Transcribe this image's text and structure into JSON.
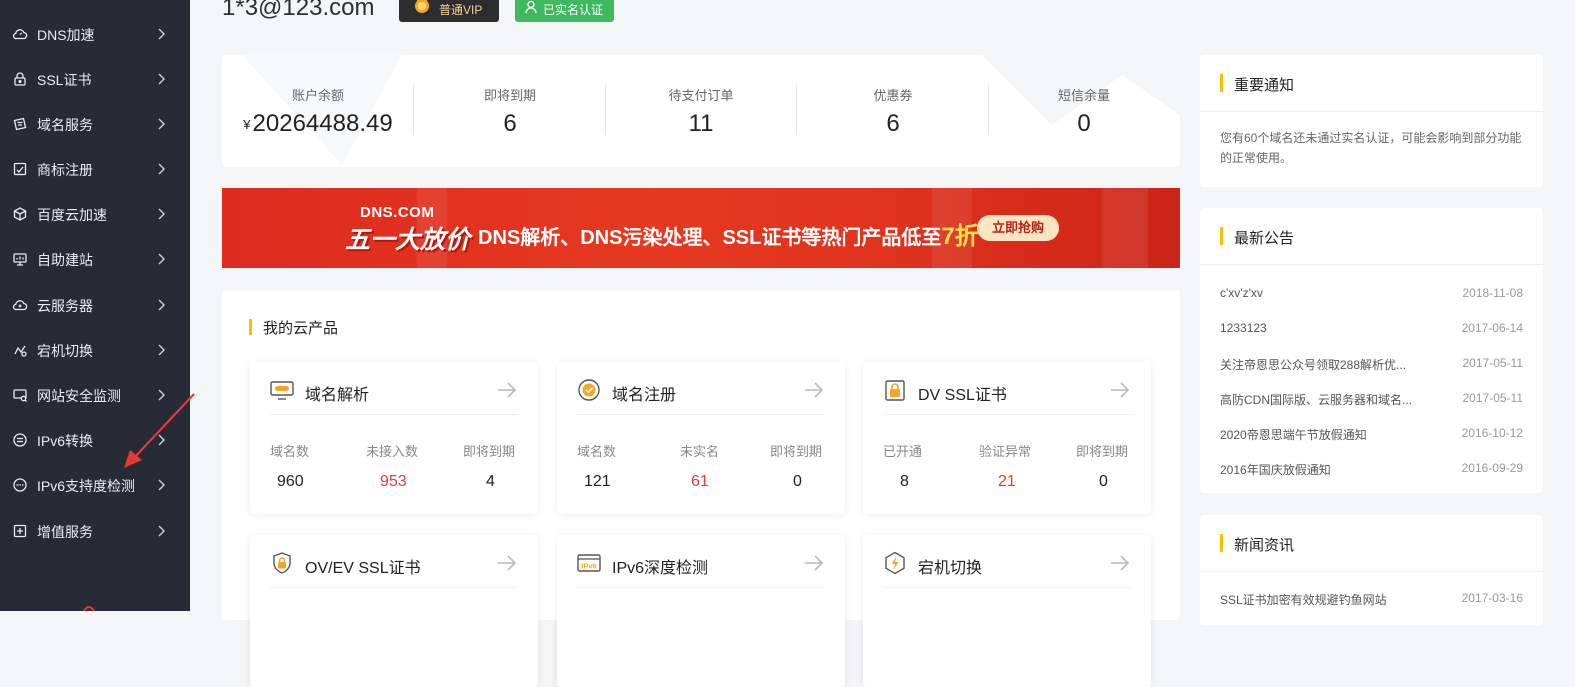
{
  "sidebar": {
    "items": [
      {
        "label": "DNS加速",
        "icon": "cloud-speed-icon"
      },
      {
        "label": "SSL证书",
        "icon": "lock-icon"
      },
      {
        "label": "域名服务",
        "icon": "domain-tag-icon"
      },
      {
        "label": "商标注册",
        "icon": "trademark-icon"
      },
      {
        "label": "百度云加速",
        "icon": "cube-icon"
      },
      {
        "label": "自助建站",
        "icon": "monitor-chart-icon"
      },
      {
        "label": "云服务器",
        "icon": "cloud-server-icon"
      },
      {
        "label": "宕机切换",
        "icon": "switch-icon"
      },
      {
        "label": "网站安全监测",
        "icon": "security-monitor-icon"
      },
      {
        "label": "IPv6转换",
        "icon": "ipv6-convert-icon"
      },
      {
        "label": "IPv6支持度检测",
        "icon": "ipv6-check-icon"
      },
      {
        "label": "增值服务",
        "icon": "value-added-icon"
      }
    ]
  },
  "header": {
    "email": "1*3@123.com",
    "vip_label": "普通VIP",
    "verified_label": "已实名认证"
  },
  "stats": {
    "currency": "¥",
    "items": [
      {
        "label": "账户余额",
        "value": "20264488.49"
      },
      {
        "label": "即将到期",
        "value": "6"
      },
      {
        "label": "待支付订单",
        "value": "11"
      },
      {
        "label": "优惠券",
        "value": "6"
      },
      {
        "label": "短信余量",
        "value": "0"
      }
    ]
  },
  "banner": {
    "brand": "DNS.COM",
    "event": "五一大放价",
    "text": "DNS解析、DNS污染处理、SSL证书等热门产品低至",
    "discount": "7折",
    "cta": "立即抢购"
  },
  "products": {
    "title": "我的云产品",
    "cards": [
      {
        "name": "域名解析",
        "icon": "dns-resolve-icon",
        "metrics": [
          {
            "label": "域名数",
            "value": "960",
            "highlight": false
          },
          {
            "label": "未接入数",
            "value": "953",
            "highlight": true
          },
          {
            "label": "即将到期",
            "value": "4",
            "highlight": false
          }
        ]
      },
      {
        "name": "域名注册",
        "icon": "domain-register-icon",
        "metrics": [
          {
            "label": "域名数",
            "value": "121",
            "highlight": false
          },
          {
            "label": "未实名",
            "value": "61",
            "highlight": true
          },
          {
            "label": "即将到期",
            "value": "0",
            "highlight": false
          }
        ]
      },
      {
        "name": "DV SSL证书",
        "icon": "dv-ssl-icon",
        "metrics": [
          {
            "label": "已开通",
            "value": "8",
            "highlight": false
          },
          {
            "label": "验证异常",
            "value": "21",
            "highlight": true
          },
          {
            "label": "即将到期",
            "value": "0",
            "highlight": false
          }
        ]
      },
      {
        "name": "OV/EV SSL证书",
        "icon": "ov-ev-ssl-icon"
      },
      {
        "name": "IPv6深度检测",
        "icon": "ipv6-depth-icon",
        "icon_text": "IPv6"
      },
      {
        "name": "宕机切换",
        "icon": "failover-icon"
      }
    ]
  },
  "notices": {
    "title": "重要通知",
    "body": "您有60个域名还未通过实名认证，可能会影响到部分功能的正常使用。"
  },
  "announcements": {
    "title": "最新公告",
    "items": [
      {
        "title": "c'xv'z'xv",
        "date": "2018-11-08"
      },
      {
        "title": "1233123",
        "date": "2017-06-14"
      },
      {
        "title": "关注帝恩思公众号领取288解析优...",
        "date": "2017-05-11"
      },
      {
        "title": "高防CDN国际版、云服务器和域名...",
        "date": "2017-05-11"
      },
      {
        "title": "2020帝恩思端午节放假通知",
        "date": "2016-10-12"
      },
      {
        "title": "2016年国庆放假通知",
        "date": "2016-09-29"
      }
    ]
  },
  "news": {
    "title": "新闻资讯",
    "items": [
      {
        "title": "SSL证书加密有效规避钓鱼网站",
        "date": "2017-03-16"
      }
    ]
  },
  "colors": {
    "sidebar_bg": "#262b35",
    "accent_yellow": "#f5c000",
    "alert_red": "#e33a3a",
    "verified_green": "#3fb85f",
    "banner_red": "#e7391f"
  }
}
